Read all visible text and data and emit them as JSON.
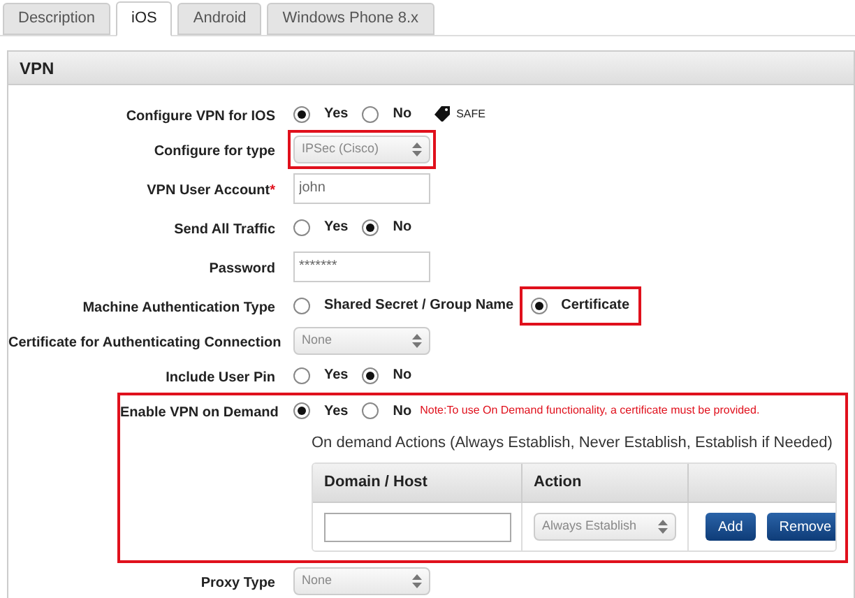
{
  "tabs": [
    {
      "label": "Description",
      "selected": false
    },
    {
      "label": "iOS",
      "selected": true
    },
    {
      "label": "Android",
      "selected": false
    },
    {
      "label": "Windows Phone 8.x",
      "selected": false
    }
  ],
  "section": {
    "title": "VPN"
  },
  "rows": [
    {
      "kind": "radio",
      "label": "Configure VPN for IOS",
      "options": [
        {
          "label": "Yes",
          "selected": true
        },
        {
          "label": "No",
          "selected": false
        }
      ],
      "tag": "SAFE"
    },
    {
      "kind": "select",
      "label": "Configure for type",
      "value": "IPSec (Cisco)",
      "highlighted": true
    },
    {
      "kind": "text",
      "label": "VPN User Account",
      "required_mark": "*",
      "value": "john"
    },
    {
      "kind": "radio",
      "label": "Send All Traffic",
      "options": [
        {
          "label": "Yes",
          "selected": false
        },
        {
          "label": "No",
          "selected": true
        }
      ]
    },
    {
      "kind": "text",
      "label": "Password",
      "value": "*******"
    },
    {
      "kind": "radio",
      "label": "Machine Authentication Type",
      "options": [
        {
          "label": "Shared Secret / Group Name",
          "selected": false,
          "highlighted": false
        },
        {
          "label": "Certificate",
          "selected": true,
          "highlighted": true
        }
      ]
    },
    {
      "kind": "select",
      "label": "Certificate for Authenticating Connection",
      "value": "None",
      "highlighted": false
    },
    {
      "kind": "radio",
      "label": "Include User Pin",
      "options": [
        {
          "label": "Yes",
          "selected": false
        },
        {
          "label": "No",
          "selected": true
        }
      ]
    },
    {
      "kind": "on_demand",
      "label": "Enable VPN on Demand",
      "highlighted": true,
      "options": [
        {
          "label": "Yes",
          "selected": true
        },
        {
          "label": "No",
          "selected": false
        }
      ],
      "note": "Note:To use On Demand functionality, a certificate must be provided.",
      "caption": "On demand Actions (Always Establish, Never Establish, Establish if Needed)",
      "table": {
        "columns": [
          "Domain / Host",
          "Action"
        ],
        "action": "Always Establish",
        "buttons": [
          "Add",
          "Remove"
        ]
      }
    },
    {
      "kind": "select",
      "label": "Proxy Type",
      "value": "None",
      "highlighted": false
    }
  ]
}
